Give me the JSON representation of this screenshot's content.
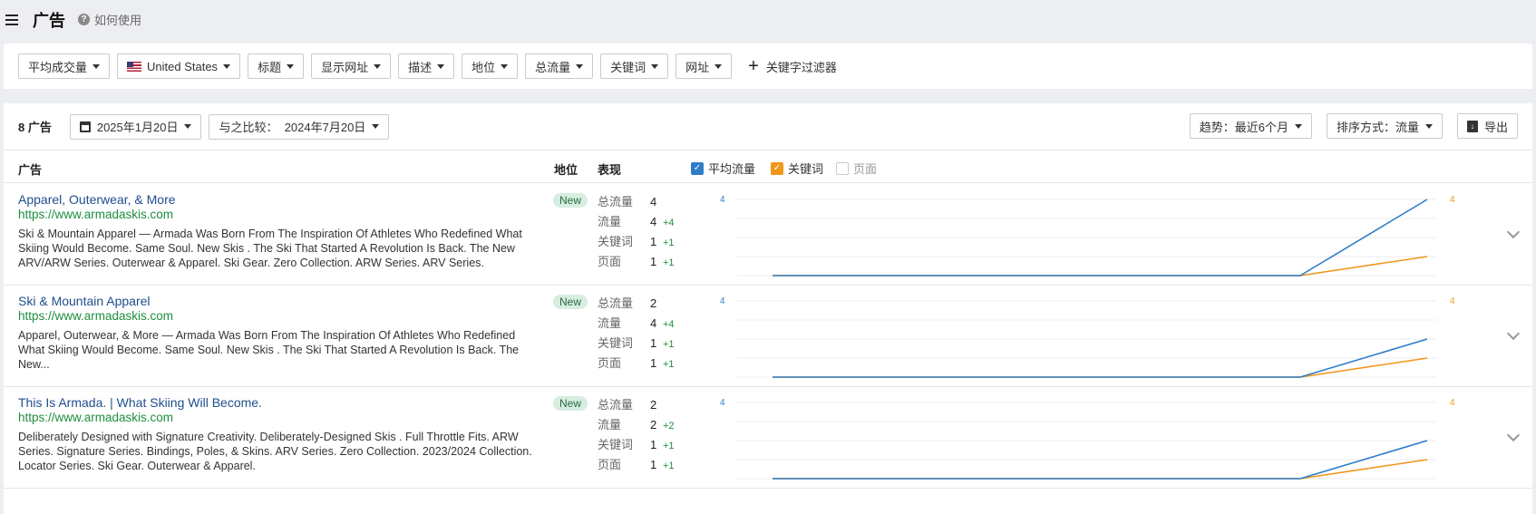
{
  "header": {
    "title": "广告",
    "help": "如何使用"
  },
  "filters": [
    {
      "label": "平均成交量"
    },
    {
      "label": "United States",
      "flag": true
    },
    {
      "label": "标题"
    },
    {
      "label": "显示网址"
    },
    {
      "label": "描述"
    },
    {
      "label": "地位"
    },
    {
      "label": "总流量"
    },
    {
      "label": "关键词"
    },
    {
      "label": "网址"
    }
  ],
  "keyword_filter": "关键字过滤器",
  "toolbar": {
    "count": "8 广告",
    "date": "2025年1月20日",
    "compare": "与之比较：  2024年7月20日",
    "trend": "趋势：最近6个月",
    "sort": "排序方式：流量",
    "export": "导出"
  },
  "table_header": {
    "ad": "广告",
    "position": "地位",
    "performance": "表现",
    "legend": {
      "avg_traffic": "平均流量",
      "keywords": "关键词",
      "pages": "页面"
    }
  },
  "colors": {
    "blue": "#2e7cc8",
    "orange": "#f0961b",
    "green": "#1e8e3e",
    "link": "#1f4e8c"
  },
  "rows": [
    {
      "title": "Apparel, Outerwear, & More",
      "url": "https://www.armadaskis.com",
      "desc": "Ski & Mountain Apparel — Armada Was Born From The Inspiration Of Athletes Who Redefined What Skiing Would Become. Same Soul. New Skis . The Ski That Started A Revolution Is Back. The New ARV/ARW Series. Outerwear & Apparel. Ski Gear. Zero Collection. ARW Series. ARV Series.",
      "badge": "New",
      "metrics": [
        {
          "label": "总流量",
          "value": "4",
          "delta": ""
        },
        {
          "label": "流量",
          "value": "4",
          "delta": "+4"
        },
        {
          "label": "关键词",
          "value": "1",
          "delta": "+1"
        },
        {
          "label": "页面",
          "value": "1",
          "delta": "+1"
        }
      ],
      "chart": {
        "left_max": "4",
        "right_max": "4",
        "blue_end": 4,
        "orange_end": 1
      }
    },
    {
      "title": "Ski & Mountain Apparel",
      "url": "https://www.armadaskis.com",
      "desc": "Apparel, Outerwear, & More — Armada Was Born From The Inspiration Of Athletes Who Redefined What Skiing Would Become. Same Soul. New Skis . The Ski That Started A Revolution Is Back. The New...",
      "badge": "New",
      "metrics": [
        {
          "label": "总流量",
          "value": "2",
          "delta": ""
        },
        {
          "label": "流量",
          "value": "4",
          "delta": "+4"
        },
        {
          "label": "关键词",
          "value": "1",
          "delta": "+1"
        },
        {
          "label": "页面",
          "value": "1",
          "delta": "+1"
        }
      ],
      "chart": {
        "left_max": "4",
        "right_max": "4",
        "blue_end": 2,
        "orange_end": 1
      }
    },
    {
      "title": "This Is Armada. | What Skiing Will Become.",
      "url": "https://www.armadaskis.com",
      "desc": "Deliberately Designed with Signature Creativity. Deliberately-Designed Skis . Full Throttle Fits. ARW Series. Signature Series. Bindings, Poles, & Skins. ARV Series. Zero Collection. 2023/2024 Collection. Locator Series. Ski Gear. Outerwear & Apparel.",
      "badge": "New",
      "metrics": [
        {
          "label": "总流量",
          "value": "2",
          "delta": ""
        },
        {
          "label": "流量",
          "value": "2",
          "delta": "+2"
        },
        {
          "label": "关键词",
          "value": "1",
          "delta": "+1"
        },
        {
          "label": "页面",
          "value": "1",
          "delta": "+1"
        }
      ],
      "chart": {
        "left_max": "4",
        "right_max": "4",
        "blue_end": 2,
        "orange_end": 1
      }
    }
  ]
}
